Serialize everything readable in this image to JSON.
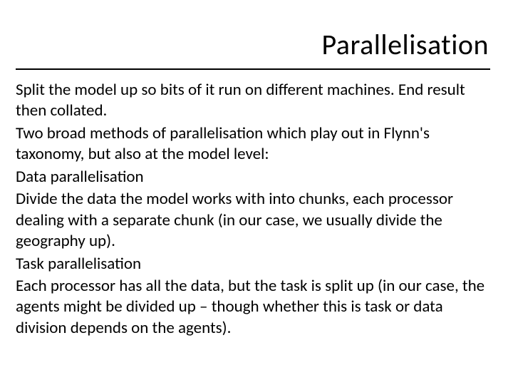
{
  "title": "Parallelisation",
  "paragraphs": {
    "p1": "Split the model up so bits of it run on different machines. End result then collated.",
    "p2": "Two broad methods of parallelisation which play out in Flynn's taxonomy, but also at the model level:",
    "p3": "Data parallelisation",
    "p4": "Divide the data the model works with into chunks, each processor dealing with a separate chunk (in our case, we usually divide the geography up).",
    "p5": "Task parallelisation",
    "p6": "Each processor has all the data, but the task is split up (in our case, the agents might be divided up – though whether this is task or data division depends on the agents)."
  }
}
